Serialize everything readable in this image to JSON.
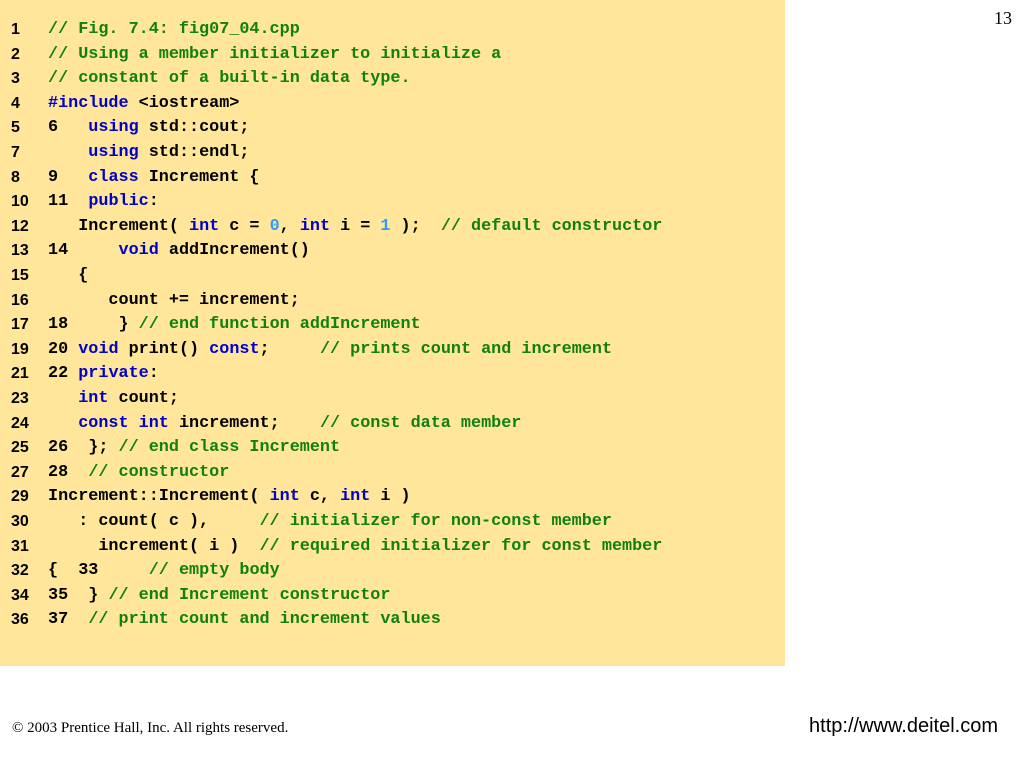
{
  "page_number": "13",
  "footer": {
    "copyright": "© 2003 Prentice Hall, Inc.   All rights reserved.",
    "url": "http://www.deitel.com"
  },
  "colors": {
    "panel": "#FFE69A",
    "keyword": "#0000CC",
    "comment": "#108010",
    "literal": "#3399FF"
  },
  "code_lines": [
    {
      "num": "1",
      "segs": [
        [
          "c",
          "// Fig. 7.4: fig07_04.cpp"
        ]
      ]
    },
    {
      "num": "2",
      "segs": [
        [
          "c",
          "// Using a member initializer to initialize a"
        ]
      ]
    },
    {
      "num": "3",
      "segs": [
        [
          "c",
          "// constant of a built-in data type."
        ]
      ]
    },
    {
      "num": "4",
      "segs": [
        [
          "k",
          "#include"
        ],
        [
          "t",
          " <iostream>"
        ]
      ]
    },
    {
      "num": "5",
      "segs": [
        [
          "n",
          "6"
        ],
        [
          "t",
          "   "
        ],
        [
          "k",
          "using"
        ],
        [
          "t",
          " std::cout;"
        ]
      ]
    },
    {
      "num": "7",
      "segs": [
        [
          "t",
          "    "
        ],
        [
          "k",
          "using"
        ],
        [
          "t",
          " std::endl;"
        ]
      ]
    },
    {
      "num": "8",
      "segs": [
        [
          "n",
          "9"
        ],
        [
          "t",
          "   "
        ],
        [
          "k",
          "class"
        ],
        [
          "t",
          " Increment {"
        ]
      ]
    },
    {
      "num": "10",
      "segs": [
        [
          "n",
          "11"
        ],
        [
          "t",
          "  "
        ],
        [
          "k",
          "public"
        ],
        [
          "t",
          ":"
        ]
      ]
    },
    {
      "num": "12",
      "segs": [
        [
          "t",
          "   Increment( "
        ],
        [
          "k",
          "int"
        ],
        [
          "t",
          " c = "
        ],
        [
          "l",
          "0"
        ],
        [
          "t",
          ", "
        ],
        [
          "k",
          "int"
        ],
        [
          "t",
          " i = "
        ],
        [
          "l",
          "1"
        ],
        [
          "t",
          " );  "
        ],
        [
          "c",
          "// default constructor"
        ]
      ]
    },
    {
      "num": "13",
      "segs": [
        [
          "n",
          "14"
        ],
        [
          "t",
          "     "
        ],
        [
          "k",
          "void"
        ],
        [
          "t",
          " addIncrement()"
        ]
      ]
    },
    {
      "num": "15",
      "segs": [
        [
          "t",
          "   {"
        ]
      ]
    },
    {
      "num": "16",
      "segs": [
        [
          "t",
          "      count += increment;"
        ]
      ]
    },
    {
      "num": "17",
      "segs": [
        [
          "n",
          "18"
        ],
        [
          "t",
          "     } "
        ],
        [
          "c",
          "// end function addIncrement"
        ]
      ]
    },
    {
      "num": "19",
      "segs": [
        [
          "n",
          "20"
        ],
        [
          "t",
          " "
        ],
        [
          "k",
          "void"
        ],
        [
          "t",
          " print() "
        ],
        [
          "k",
          "const"
        ],
        [
          "t",
          ";     "
        ],
        [
          "c",
          "// prints count and increment"
        ]
      ]
    },
    {
      "num": "21",
      "segs": [
        [
          "n",
          "22"
        ],
        [
          "t",
          " "
        ],
        [
          "k",
          "private"
        ],
        [
          "t",
          ":"
        ]
      ]
    },
    {
      "num": "23",
      "segs": [
        [
          "t",
          "   "
        ],
        [
          "k",
          "int"
        ],
        [
          "t",
          " count;"
        ]
      ]
    },
    {
      "num": "24",
      "segs": [
        [
          "t",
          "   "
        ],
        [
          "k",
          "const"
        ],
        [
          "t",
          " "
        ],
        [
          "k",
          "int"
        ],
        [
          "t",
          " increment;    "
        ],
        [
          "c",
          "// const data member"
        ]
      ]
    },
    {
      "num": "25",
      "segs": [
        [
          "n",
          "26"
        ],
        [
          "t",
          "  }; "
        ],
        [
          "c",
          "// end class Increment"
        ]
      ]
    },
    {
      "num": "27",
      "segs": [
        [
          "n",
          "28"
        ],
        [
          "t",
          "  "
        ],
        [
          "c",
          "// constructor"
        ]
      ]
    },
    {
      "num": "29",
      "segs": [
        [
          "t",
          "Increment::Increment( "
        ],
        [
          "k",
          "int"
        ],
        [
          "t",
          " c, "
        ],
        [
          "k",
          "int"
        ],
        [
          "t",
          " i )"
        ]
      ]
    },
    {
      "num": "30",
      "segs": [
        [
          "t",
          "   : count( c ),     "
        ],
        [
          "c",
          "// initializer for non-const member"
        ]
      ]
    },
    {
      "num": "31",
      "segs": [
        [
          "t",
          "     increment( i )  "
        ],
        [
          "c",
          "// required initializer for const member"
        ]
      ]
    },
    {
      "num": "32",
      "segs": [
        [
          "t",
          "{  "
        ],
        [
          "n",
          "33"
        ],
        [
          "t",
          "     "
        ],
        [
          "c",
          "// empty body"
        ]
      ]
    },
    {
      "num": "34",
      "segs": [
        [
          "n",
          "35"
        ],
        [
          "t",
          "  } "
        ],
        [
          "c",
          "// end Increment constructor"
        ]
      ]
    },
    {
      "num": "36",
      "segs": [
        [
          "n",
          "37"
        ],
        [
          "t",
          "  "
        ],
        [
          "c",
          "// print count and increment values"
        ]
      ]
    }
  ]
}
